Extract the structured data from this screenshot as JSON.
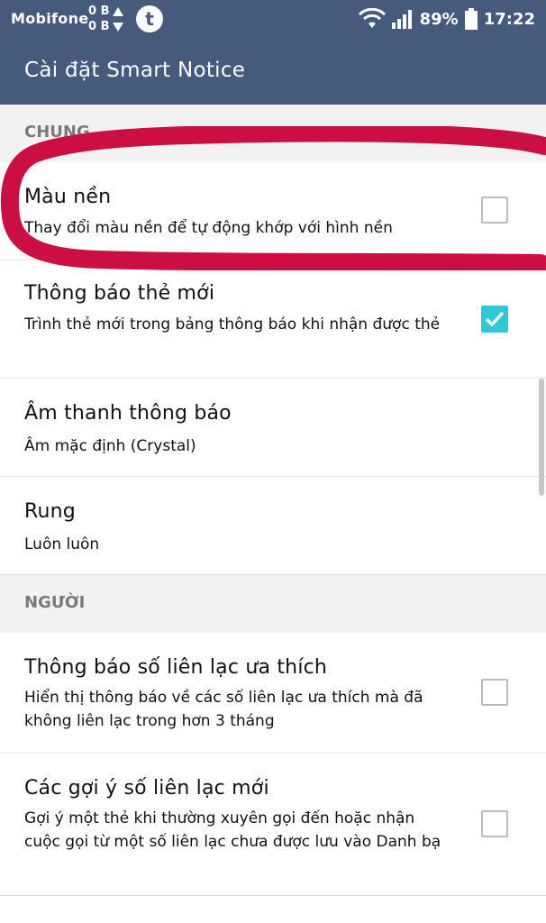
{
  "status_bar": {
    "carrier": "Mobifone",
    "upload": "0 B",
    "download": "0 B",
    "app_badge": "t",
    "battery": "89%",
    "time": "17:22"
  },
  "app_bar": {
    "title": "Cài đặt Smart Notice"
  },
  "sections": {
    "general": {
      "header": "CHUNG",
      "background_color": {
        "title": "Màu nền",
        "subtitle": "Thay đổi màu nền để tự động khớp với hình nền",
        "checked": false
      },
      "new_card_notice": {
        "title": "Thông báo thẻ mới",
        "subtitle": "Trình thẻ mới trong bảng thông báo khi nhận được thẻ",
        "checked": true
      },
      "notification_sound": {
        "title": "Âm thanh thông báo",
        "subtitle": "Âm mặc định (Crystal)"
      },
      "vibrate": {
        "title": "Rung",
        "subtitle": "Luôn luôn"
      }
    },
    "people": {
      "header": "NGƯỜI",
      "favorite_contacts": {
        "title": "Thông báo số liên lạc ưa thích",
        "subtitle": "Hiển thị thông báo về các số liên lạc ưa thích mà đã không liên lạc trong hơn 3 tháng",
        "checked": false
      },
      "new_contact_suggestions": {
        "title": "Các gợi ý số liên lạc mới",
        "subtitle": "Gợi ý một thẻ khi thường xuyên gọi đến hoặc nhận cuộc gọi từ một số liên lạc chưa được lưu vào Danh bạ",
        "checked": false
      }
    }
  },
  "colors": {
    "header_bg": "#465a7b",
    "checkbox_checked": "#2ec8d6",
    "annotation": "#cc0f43"
  }
}
